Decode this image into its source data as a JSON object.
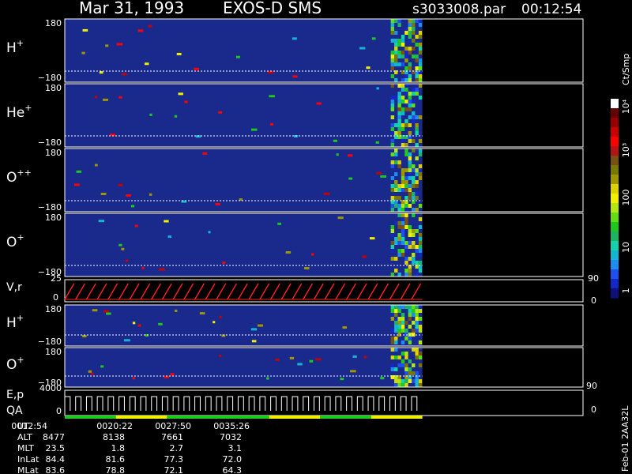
{
  "header": {
    "date": "Mar 31, 1993",
    "mission": "EXOS-D SMS",
    "file": "s3033008.par",
    "time": "00:12:54"
  },
  "colorbar": {
    "label": "Ct/Smp",
    "ticks": [
      "1",
      "10",
      "100",
      "10³",
      "10⁴"
    ],
    "colors": [
      "#10107a",
      "#1428c8",
      "#1e50f0",
      "#1e8cf0",
      "#14b4d2",
      "#14d2aa",
      "#1eb464",
      "#1ec81e",
      "#64dc14",
      "#b4e614",
      "#f0f000",
      "#dcd200",
      "#a09600",
      "#787800",
      "#785014",
      "#b41414",
      "#ff0000",
      "#c80000",
      "#960000",
      "#640000",
      "#ffffff"
    ]
  },
  "colors": {
    "background": "#000000",
    "panel_bg": "#1a2a8c",
    "frame": "#ffffff",
    "trace": "#ff2020"
  },
  "chart_data": [
    {
      "type": "heatmap",
      "panel": "H+",
      "label": "H",
      "sup": "+",
      "ylim": [
        -180,
        180
      ],
      "yticks": [
        "180",
        "−180"
      ],
      "data_end_fraction": 0.69
    },
    {
      "type": "heatmap",
      "panel": "He+",
      "label": "He",
      "sup": "+",
      "ylim": [
        -180,
        180
      ],
      "yticks": [
        "180",
        "−180"
      ],
      "data_end_fraction": 0.69
    },
    {
      "type": "heatmap",
      "panel": "O++",
      "label": "O",
      "sup": "++",
      "ylim": [
        -180,
        180
      ],
      "yticks": [
        "180",
        "−180"
      ],
      "data_end_fraction": 0.69
    },
    {
      "type": "heatmap",
      "panel": "O+",
      "label": "O",
      "sup": "+",
      "ylim": [
        -180,
        180
      ],
      "yticks": [
        "180",
        "−180"
      ],
      "data_end_fraction": 0.69
    },
    {
      "type": "line",
      "panel": "V,r",
      "label": "V,r",
      "yticks": [
        "25",
        "0"
      ],
      "right_ticks": [
        "90",
        "0"
      ],
      "sweep_count": 33
    },
    {
      "type": "heatmap",
      "panel": "H+ (2)",
      "label": "H",
      "sup": "+",
      "ylim": [
        -180,
        180
      ],
      "yticks": [
        "180",
        "−180"
      ],
      "data_end_fraction": 0.69
    },
    {
      "type": "heatmap",
      "panel": "O+ (2)",
      "label": "O",
      "sup": "+",
      "ylim": [
        -180,
        180
      ],
      "yticks": [
        "180",
        "−180"
      ],
      "data_end_fraction": 0.69
    },
    {
      "type": "line",
      "panel": "E,p QA",
      "label": "E,p",
      "label2": "QA",
      "yticks": [
        "4000",
        "0"
      ],
      "right_ticks": [
        "90",
        "0"
      ],
      "step_count": 33
    }
  ],
  "ephemeris": {
    "row_labels": [
      "UT",
      "ALT",
      "MLT",
      "InLat",
      "MLat"
    ],
    "columns": [
      [
        "0012:54",
        "8477",
        "23.5",
        "84.4",
        "83.6"
      ],
      [
        "0020:22",
        "8138",
        "1.8",
        "81.6",
        "78.8"
      ],
      [
        "0027:50",
        "7661",
        "2.7",
        "77.3",
        "72.1"
      ],
      [
        "0035:26",
        "7032",
        "3.1",
        "72.0",
        "64.3"
      ]
    ]
  },
  "footer_tag": "Feb-01 2AA32L"
}
